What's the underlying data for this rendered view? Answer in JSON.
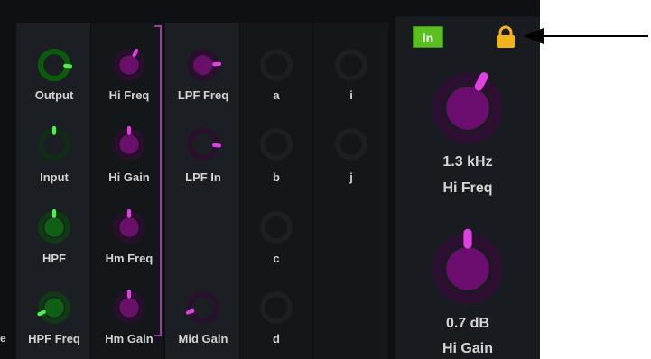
{
  "channel_strip": {
    "columns": [
      {
        "knobs": [
          {
            "label": "Output",
            "style": "green",
            "value": 0.85
          },
          {
            "label": "Input",
            "style": "green-dim",
            "value": 0.5
          },
          {
            "label": "HPF",
            "style": "green-solid",
            "value": 0.5
          },
          {
            "label": "HPF Freq",
            "style": "green-solid",
            "value": 0.08
          }
        ]
      },
      {
        "knobs": [
          {
            "label": "Hi Freq",
            "style": "purple",
            "value": 0.6
          },
          {
            "label": "Hi Gain",
            "style": "purple",
            "value": 0.5
          },
          {
            "label": "Hm Freq",
            "style": "purple",
            "value": 0.5
          },
          {
            "label": "Hm Gain",
            "style": "purple",
            "value": 0.5
          }
        ]
      },
      {
        "knobs": [
          {
            "label": "LPF Freq",
            "style": "purple",
            "value": 0.82
          },
          {
            "label": "LPF In",
            "style": "purple-ring",
            "value": 0.85
          },
          {
            "label": "",
            "style": "none",
            "value": 0
          },
          {
            "label": "Mid Gain",
            "style": "purple-ring",
            "value": 0.1
          }
        ]
      },
      {
        "knobs": [
          {
            "label": "a",
            "style": "empty",
            "value": 0
          },
          {
            "label": "b",
            "style": "empty",
            "value": 0
          },
          {
            "label": "c",
            "style": "empty",
            "value": 0
          },
          {
            "label": "d",
            "style": "empty",
            "value": 0
          }
        ]
      },
      {
        "knobs": [
          {
            "label": "i",
            "style": "empty",
            "value": 0
          },
          {
            "label": "j",
            "style": "empty",
            "value": 0
          },
          {
            "label": "",
            "style": "none",
            "value": 0
          },
          {
            "label": "",
            "style": "none",
            "value": 0
          }
        ]
      }
    ],
    "edge_text": "e"
  },
  "inspector": {
    "in_button_label": "In",
    "lock_icon": "lock-icon",
    "params": [
      {
        "value_text": "1.3 kHz",
        "name": "Hi Freq",
        "value": 0.6
      },
      {
        "value_text": "0.7 dB",
        "name": "Hi Gain",
        "value": 0.5
      }
    ]
  },
  "colors": {
    "green_accent": "#2fd02f",
    "purple_accent": "#e040e0",
    "purple_body": "#6a0f6a",
    "in_button": "#5bbf22",
    "lock": "#f2b41c"
  }
}
